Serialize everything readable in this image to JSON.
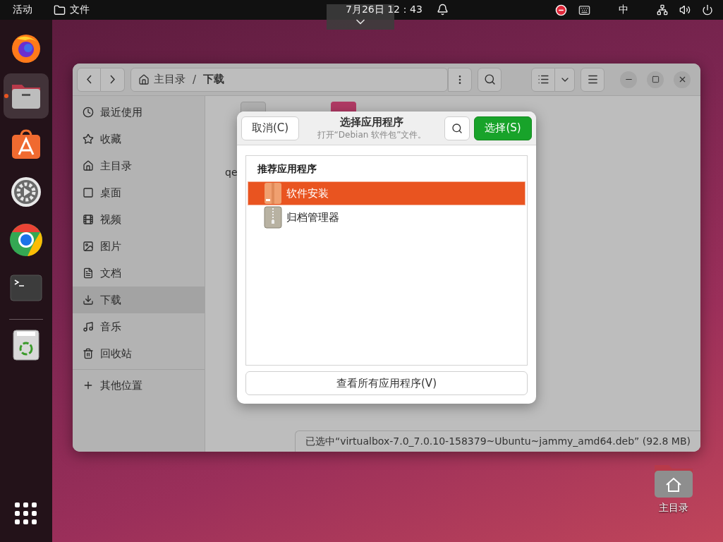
{
  "top_bar": {
    "activities": "活动",
    "app_menu": "文件",
    "clock": "7月26日 12：43",
    "input_method": "中"
  },
  "dock": {
    "apps": [
      {
        "kind": "browser",
        "running": false,
        "selected": false
      },
      {
        "kind": "files",
        "running": true,
        "selected": true
      },
      {
        "kind": "store",
        "running": false,
        "selected": false
      },
      {
        "kind": "settings",
        "running": false,
        "selected": false
      },
      {
        "kind": "chrome",
        "running": false,
        "selected": false
      },
      {
        "kind": "terminal",
        "running": false,
        "selected": false
      },
      {
        "kind": "trash",
        "running": false,
        "selected": false
      }
    ]
  },
  "file_window": {
    "path": [
      {
        "label": "主目录",
        "kind": "home"
      },
      {
        "label": "下载",
        "kind": "folder"
      }
    ],
    "path_separator": "/",
    "sidebar": {
      "items": [
        {
          "label": "最近使用",
          "kind": "recent",
          "selected": false
        },
        {
          "label": "收藏",
          "kind": "starred",
          "selected": false
        },
        {
          "label": "主目录",
          "kind": "home",
          "selected": false
        },
        {
          "label": "桌面",
          "kind": "desktop",
          "selected": false
        },
        {
          "label": "视频",
          "kind": "videos",
          "selected": false
        },
        {
          "label": "图片",
          "kind": "pictures",
          "selected": false
        },
        {
          "label": "文档",
          "kind": "documents",
          "selected": false
        },
        {
          "label": "下载",
          "kind": "downloads",
          "selected": true
        },
        {
          "label": "音乐",
          "kind": "music",
          "selected": false
        },
        {
          "label": "回收站",
          "kind": "trash",
          "selected": false
        }
      ],
      "other": {
        "label": "其他位置"
      }
    },
    "files": [
      {
        "label": "qe",
        "kind": "archive"
      },
      {
        "kind": "package"
      }
    ],
    "status": "已选中“virtualbox-7.0_7.0.10-158379~Ubuntu~jammy_amd64.deb” (92.8 MB)"
  },
  "dialog": {
    "cancel": "取消(C)",
    "title": "选择应用程序",
    "subtitle": "打开“Debian 软件包”文件。",
    "select": "选择(S)",
    "section": "推荐应用程序",
    "apps": [
      {
        "label": "软件安装",
        "kind": "package",
        "selected": true
      },
      {
        "label": "归档管理器",
        "kind": "archive",
        "selected": false
      }
    ],
    "view_all": "查看所有应用程序(V)"
  },
  "desktop_icons": [
    {
      "label": "主目录",
      "kind": "home"
    }
  ]
}
